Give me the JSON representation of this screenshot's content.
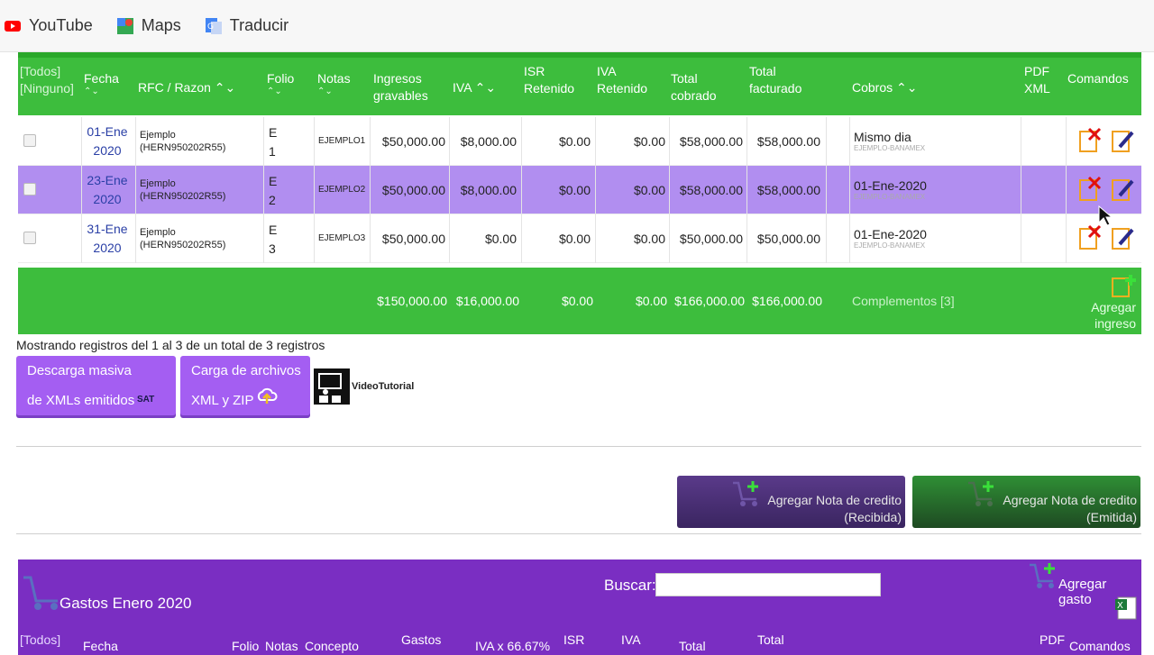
{
  "bookmarks": [
    {
      "label": "YouTube",
      "icon": "youtube-icon",
      "color": "#ff0000"
    },
    {
      "label": "Maps",
      "icon": "maps-icon",
      "color": "#34a853"
    },
    {
      "label": "Traducir",
      "icon": "translate-icon",
      "color": "#4285f4"
    }
  ],
  "income_table": {
    "headers": {
      "select_all": "[Todos]",
      "select_none": "[Ninguno]",
      "fecha": "Fecha",
      "rfc": "RFC / Razon",
      "folio": "Folio",
      "notas": "Notas",
      "ingresos": "Ingresos gravables",
      "iva": "IVA",
      "isr": "ISR Retenido",
      "iva_ret": "IVA Retenido",
      "total_cobrado": "Total cobrado",
      "total_facturado": "Total facturado",
      "cobros": "Cobros",
      "pdf": "PDF XML",
      "comandos": "Comandos"
    },
    "rows": [
      {
        "fecha": "01-Ene 2020",
        "rfc_name": "Ejemplo",
        "rfc": "(HERN950202R55)",
        "folio": "E 1",
        "notas": "EJEMPLO1",
        "ingresos": "$50,000.00",
        "iva": "$8,000.00",
        "isr": "$0.00",
        "iva_ret": "$0.00",
        "total_cobrado": "$58,000.00",
        "total_facturado": "$58,000.00",
        "cobros": "Mismo dia",
        "cobros_sub": "EJEMPLO-BANAMEX"
      },
      {
        "fecha": "23-Ene 2020",
        "rfc_name": "Ejemplo",
        "rfc": "(HERN950202R55)",
        "folio": "E 2",
        "notas": "EJEMPLO2",
        "ingresos": "$50,000.00",
        "iva": "$8,000.00",
        "isr": "$0.00",
        "iva_ret": "$0.00",
        "total_cobrado": "$58,000.00",
        "total_facturado": "$58,000.00",
        "cobros": "01-Ene-2020",
        "cobros_sub": "EJEMPLO-BANAMEX"
      },
      {
        "fecha": "31-Ene 2020",
        "rfc_name": "Ejemplo",
        "rfc": "(HERN950202R55)",
        "folio": "E 3",
        "notas": "EJEMPLO3",
        "ingresos": "$50,000.00",
        "iva": "$0.00",
        "isr": "$0.00",
        "iva_ret": "$0.00",
        "total_cobrado": "$50,000.00",
        "total_facturado": "$50,000.00",
        "cobros": "01-Ene-2020",
        "cobros_sub": "EJEMPLO-BANAMEX"
      }
    ],
    "totals": {
      "ingresos": "$150,000.00",
      "iva": "$16,000.00",
      "isr": "$0.00",
      "iva_ret": "$0.00",
      "total_cobrado": "$166,000.00",
      "total_facturado": "$166,000.00",
      "complementos": "Complementos [3]",
      "agregar_ingreso": "Agregar ingreso"
    },
    "selected_row": 1
  },
  "info_text": "Mostrando registros del 1 al 3 de un total de 3 registros",
  "buttons": {
    "descarga_line1": "Descarga masiva",
    "descarga_line2": "de XMLs emitidos",
    "descarga_logo": "SAT",
    "carga_line1": "Carga de archivos",
    "carga_line2": "XML y ZIP",
    "video": "VideoTutorial",
    "nota_recibida_1": "Agregar Nota de credito",
    "nota_recibida_2": "(Recibida)",
    "nota_emitida_1": "Agregar Nota de credito",
    "nota_emitida_2": "(Emitida)"
  },
  "gastos": {
    "title": "Gastos Enero 2020",
    "search_label": "Buscar:",
    "search_value": "",
    "add": "Agregar gasto",
    "headers": {
      "todos": "[Todos]",
      "fecha": "Fecha",
      "folio": "Folio",
      "notas": "Notas",
      "concepto": "Concepto",
      "gastos": "Gastos",
      "iva": "IVA x 66.67%",
      "isr": "ISR",
      "iva2": "IVA",
      "total": "Total",
      "total2": "Total",
      "pdf": "PDF",
      "comandos": "Comandos"
    }
  },
  "colors": {
    "green": "#3dbd3d",
    "purple": "#7a2ec2",
    "selected": "#b18ef0",
    "button_purple": "#a45ef2"
  }
}
